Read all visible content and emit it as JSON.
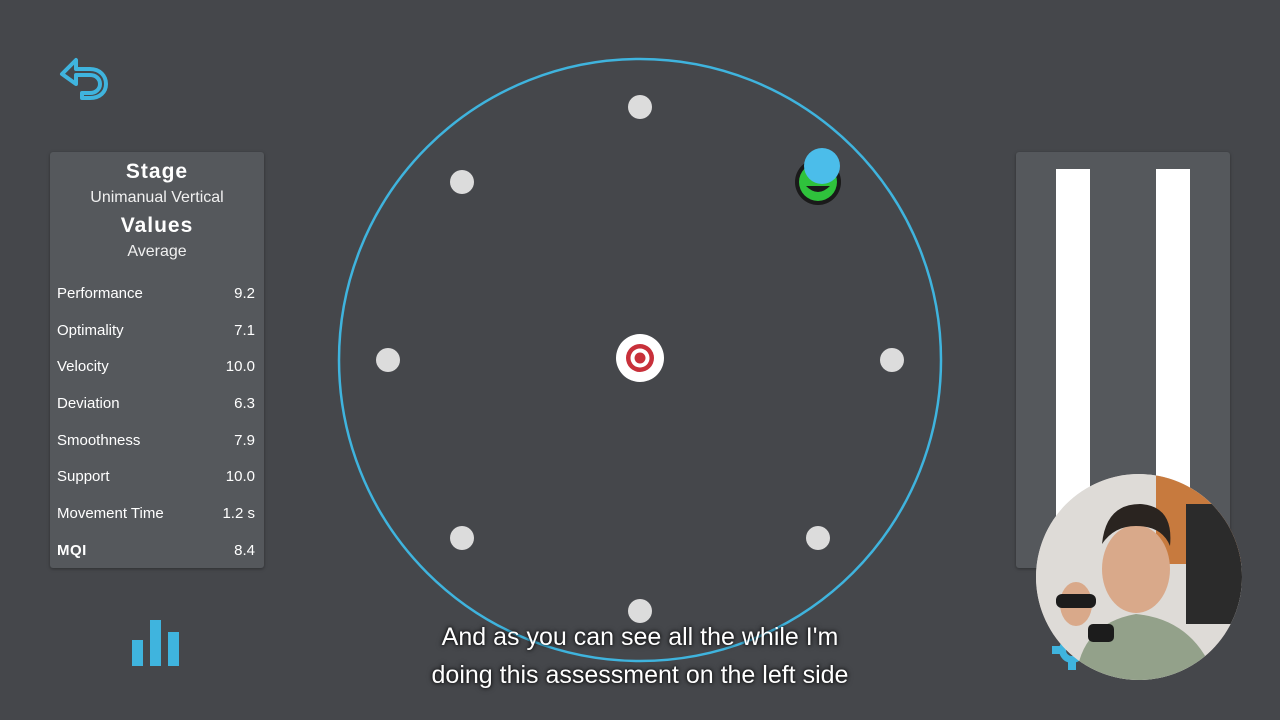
{
  "colors": {
    "background": "#45474b",
    "panel": "#55585c",
    "accent": "#3fb4de",
    "target_ring": "#c8303a",
    "success": "#2fc23c"
  },
  "nav": {
    "back_icon": "undo-arrow-icon"
  },
  "stats_panel": {
    "stage_title": "Stage",
    "stage_value": "Unimanual Vertical",
    "values_title": "Values",
    "values_mode": "Average",
    "metrics": [
      {
        "label": "Performance",
        "value": "9.2"
      },
      {
        "label": "Optimality",
        "value": "7.1"
      },
      {
        "label": "Velocity",
        "value": "10.0"
      },
      {
        "label": "Deviation",
        "value": "6.3"
      },
      {
        "label": "Smoothness",
        "value": "7.9"
      },
      {
        "label": "Support",
        "value": "10.0"
      },
      {
        "label": "Movement Time",
        "value": "1.2 s"
      },
      {
        "label": "MQI",
        "value": "8.4"
      }
    ]
  },
  "arena": {
    "center_icon": "bullseye-icon",
    "reached_target_icon": "smiley-face-icon",
    "cursor_icon": "cursor-dot-icon"
  },
  "bottom_bar": {
    "stats_icon": "bar-chart-icon",
    "settings_icon": "gear-icon"
  },
  "subtitle": {
    "line1": "And as you can see all the while I'm",
    "line2": "doing this assessment on the left side"
  }
}
